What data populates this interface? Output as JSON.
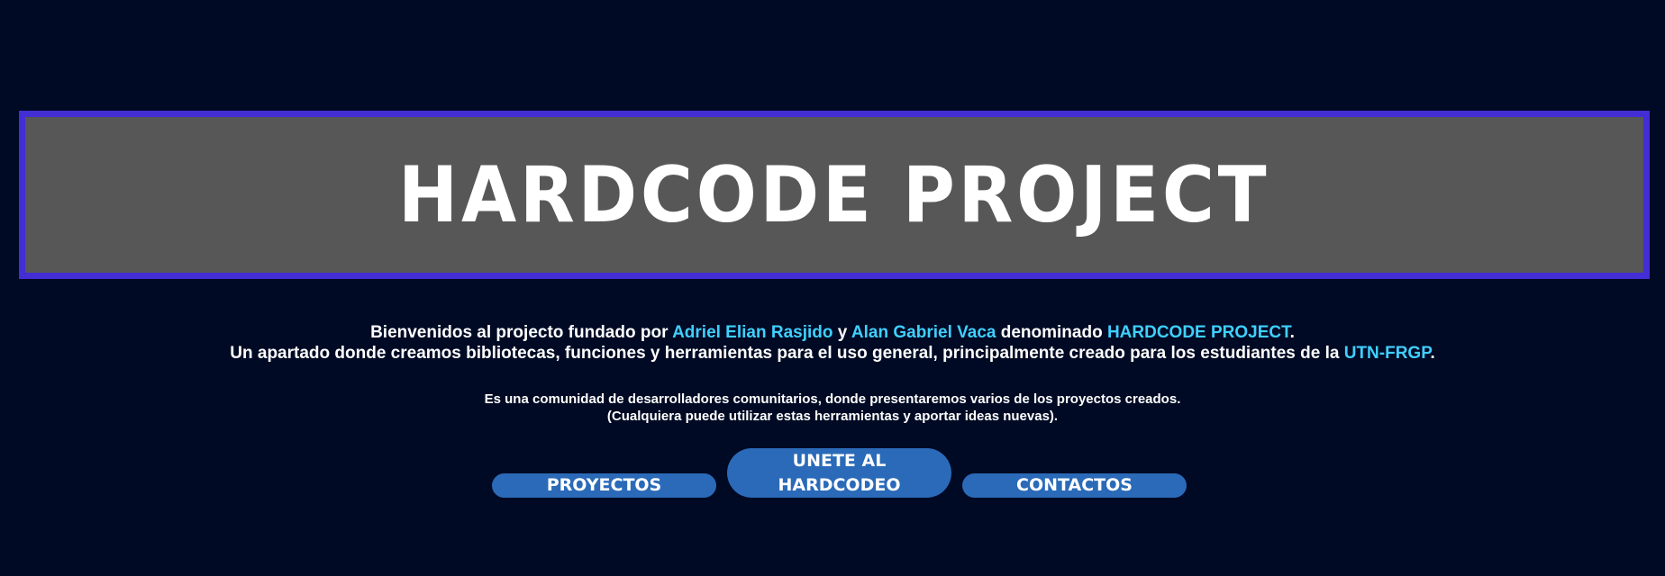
{
  "header": {
    "title": "HARDCODE PROJECT"
  },
  "intro": {
    "line1_a": "Bienvenidos al projecto fundado por ",
    "author1": "Adriel Elian Rasjido",
    "line1_b": " y ",
    "author2": "Alan Gabriel Vaca",
    "line1_c": " denominado ",
    "project": "HARDCODE PROJECT",
    "line1_d": ".",
    "line2_a": "Un apartado donde creamos bibliotecas, funciones y herramientas para el uso general, principalmente creado para los estudiantes de la ",
    "org": "UTN-FRGP",
    "line2_b": "."
  },
  "sub": {
    "line1": "Es una comunidad de desarrolladores comunitarios, donde presentaremos varios de los proyectos creados.",
    "line2": "(Cualquiera puede utilizar estas herramientas y aportar ideas nuevas)."
  },
  "buttons": {
    "projects": "PROYECTOS",
    "join": "UNETE AL HARDCODEO",
    "contacts": "CONTACTOS"
  },
  "colors": {
    "background": "#000a24",
    "banner": "#575757",
    "border": "#432dd4",
    "highlight": "#3fd0ff",
    "button": "#2a6ab8"
  }
}
